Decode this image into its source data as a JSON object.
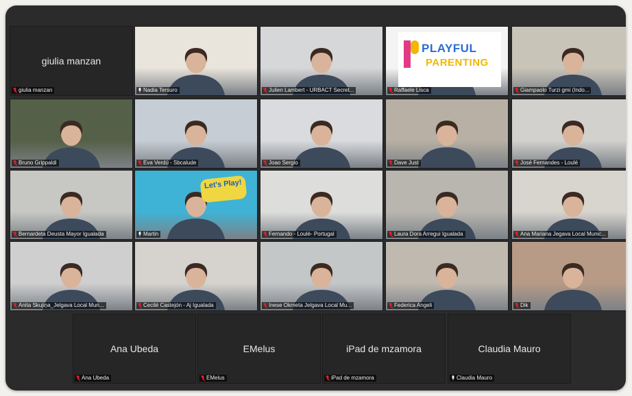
{
  "app": "Zoom gallery view",
  "rows": [
    [
      {
        "name": "giulia manzan",
        "center_name": "giulia manzan",
        "muted": true,
        "video": false
      },
      {
        "name": "Nadia Tersuro",
        "muted": false,
        "video": true,
        "bg": "#e9e4dc"
      },
      {
        "name": "Julien Lambert - URBACT Secret...",
        "muted": true,
        "video": true,
        "bg": "#d6d7d8"
      },
      {
        "name": "Raffaele Lisca",
        "muted": true,
        "video": true,
        "bg": "#f4f4f4",
        "placard": true
      },
      {
        "name": "Giampaolo Turzi gmi (Indo...",
        "muted": true,
        "video": true,
        "bg": "#c9c4b8"
      }
    ],
    [
      {
        "name": "Bruno Grippaldi",
        "muted": true,
        "video": true,
        "bg": "#556048"
      },
      {
        "name": "Eva Verdú - Sbcalude",
        "muted": true,
        "video": true,
        "bg": "#c6cdd4"
      },
      {
        "name": "Joao Sergio",
        "muted": true,
        "video": true,
        "bg": "#d9dbde"
      },
      {
        "name": "Dave Just",
        "muted": true,
        "video": true,
        "bg": "#b8b0a4"
      },
      {
        "name": "José Fernandes - Loulé",
        "muted": true,
        "video": true,
        "bg": "#d2d1cd"
      }
    ],
    [
      {
        "name": "Bernardeta Deusta Mayor Igualada",
        "muted": true,
        "video": true,
        "bg": "#c7c8c4"
      },
      {
        "name": "Martin",
        "muted": false,
        "video": true,
        "bg": "#3fb3d6",
        "sign": true
      },
      {
        "name": "Fernando - Loulé- Portugal",
        "muted": true,
        "video": true,
        "bg": "#dddedc"
      },
      {
        "name": "Laura Dora Arregui Igualada",
        "muted": true,
        "video": true,
        "bg": "#b9b6b0"
      },
      {
        "name": "Ana Mariana Jegava Local Munic...",
        "muted": true,
        "video": true,
        "bg": "#d8d5cf"
      }
    ],
    [
      {
        "name": "Anita Skujiņa_Jelgava Local Mun...",
        "muted": true,
        "video": true,
        "bg": "#cfcfd0"
      },
      {
        "name": "Cecilé Castejón - Aj Igualada",
        "muted": true,
        "video": true,
        "bg": "#d6d3cf"
      },
      {
        "name": "Inese Okmeta Jelgava Local Mu...",
        "muted": true,
        "video": true,
        "bg": "#c4c7c8"
      },
      {
        "name": "Federica Angeli",
        "muted": true,
        "video": true,
        "bg": "#bfb9b0"
      },
      {
        "name": "Dik",
        "muted": true,
        "video": true,
        "bg": "#b79b86"
      }
    ],
    [
      {
        "name": "Ana Ubeda",
        "center_name": "Ana Ubeda",
        "muted": true,
        "video": false
      },
      {
        "name": "EMelus",
        "center_name": "EMelus",
        "muted": true,
        "video": false
      },
      {
        "name": "iPad de mzamora",
        "center_name": "iPad de mzamora",
        "muted": true,
        "video": false
      },
      {
        "name": "Claudia Mauro",
        "center_name": "Claudia Mauro",
        "muted": false,
        "video": false
      }
    ]
  ],
  "placard": {
    "line1": "PLAYFUL",
    "line2": "PARENTING"
  },
  "sign": {
    "text": "Let's Play!"
  },
  "colors": {
    "mic_muted": "#e0202a",
    "frame": "#2b2b2b",
    "label_bg": "rgba(0,0,0,.62)"
  }
}
